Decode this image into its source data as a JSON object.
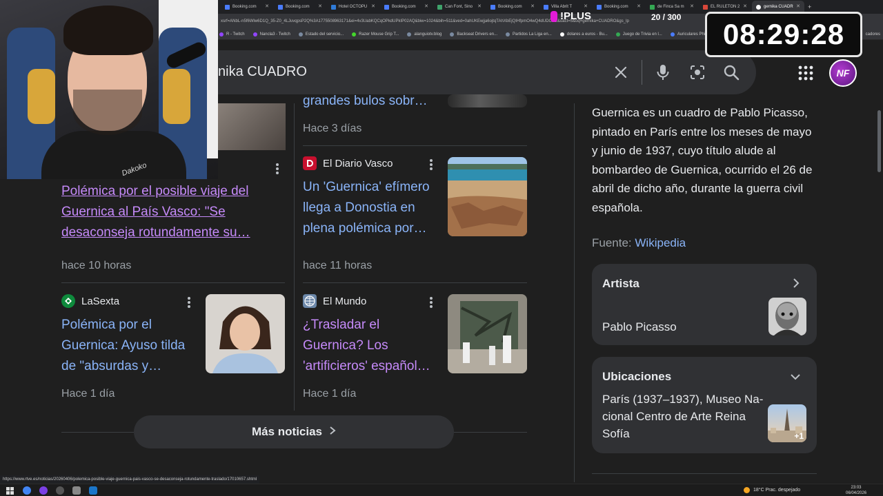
{
  "browser": {
    "tabs": [
      "Booking.com",
      "Booking.com",
      "Hotel OCTOPU",
      "Booking.com",
      "Can Font, Sino",
      "Booking.com",
      "Villa Abrit T",
      "Booking.com",
      "de Finca Sa m",
      "EL RULETON 2",
      "gernika CUADR"
    ],
    "address": "xsrf=ANbL-n5f6Wlw6D1Q_35-Z0_4LJuvqpsP2Q%3A1775508963171&ei=4v3UabKQCqOPkdUPkIP02AQ&biw=1024&bih=511&ved=0ahUKEwjja6ojtqTAhXbEjQIHfpmO4wQ4dUDCBE&uact=5&oq=gernika+CUADRO&gs_lp",
    "bookmarks": [
      "R - Twitch",
      "Nancla3 - Twitch",
      "Estado del servicio...",
      "Razer Mouse Grip T...",
      "alanguiotv.blog",
      "Backseat Drivers en...",
      "Partidos La Liga en...",
      "dolares a euros - Bu...",
      "Juego de Trivia en l...",
      "Auriculares Philips l...",
      "cadores"
    ]
  },
  "overlay": {
    "plus_label": "!PLUS",
    "counter": "20 / 300",
    "timer": "08:29:28",
    "webcam_signature": "Dakoko"
  },
  "search": {
    "query": "nika CUADRO",
    "avatar_text": "NF"
  },
  "news": {
    "top_left_time": "",
    "top_right": {
      "title_fragment": "grandes bulos sobr…",
      "time": "Hace 3 días"
    },
    "cards": [
      {
        "source": "",
        "title": "Polémica por el posible viaje del Guernica al País Vasco: \"Se desaconseja rotundamente su…",
        "time": "hace 10 horas"
      },
      {
        "source": "El Diario Vasco",
        "title": "Un 'Guernica' efímero llega a Donostia en plena polémica por…",
        "time": "hace 11 horas"
      },
      {
        "source": "LaSexta",
        "title": "Polémica por el Guernica: Ayuso tilda de \"absurdas y…",
        "time": "Hace 1 día"
      },
      {
        "source": "El Mundo",
        "title": "¿Trasladar el Guernica? Los 'artificieros' español…",
        "time": "Hace 1 día"
      }
    ],
    "more_button": "Más noticias"
  },
  "knowledge_panel": {
    "description": "Guernica es un cuadro de Pablo Picasso, pintado en París entre los meses de mayo y junio de 1937, cuyo título alude al bombardeo de Guernica, ocurrido el 26 de abril de dicho año, durante la guerra civil española.",
    "source_label": "Fuente:",
    "source_link": "Wikipedia",
    "artist_heading": "Artista",
    "artist_value": "Pablo Picasso",
    "locations_heading": "Ubicaciones",
    "locations_value_1": "París (1937–1937), Museo Na-",
    "locations_value_2": "cional Centro de Arte Reina",
    "locations_value_3": "Sofía",
    "locations_badge": "+1"
  },
  "status_url": "https://www.rtve.es/noticias/20260406/polemica-posible-viaje-guernica-pais-vasco-se-desaconseja-rotundamente-traslado/17010657.shtml",
  "taskbar": {
    "weather": "18°C  Prac. despejado",
    "time": "23:03",
    "date": "06/04/2026"
  },
  "colors": {
    "link_blue": "#8ab4f8",
    "visited_purple": "#c58af9",
    "plus_accent": "#e21bd6"
  }
}
